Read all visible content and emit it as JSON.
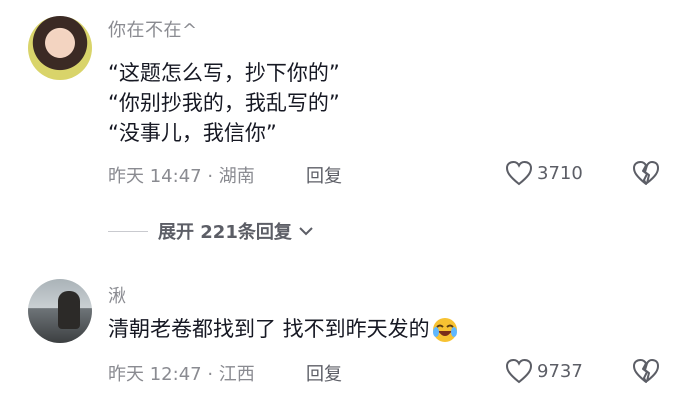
{
  "comments": [
    {
      "username": "你在不在^",
      "lines": [
        "“这题怎么写，抄下你的”",
        "“你别抄我的，我乱写的”",
        "“没事儿，我信你”"
      ],
      "time_location": "昨天 14:47 · 湖南",
      "reply_label": "回复",
      "likes": "3710"
    },
    {
      "username": "湫",
      "text": "清朝老卷都找到了 找不到昨天发的",
      "emoji": "laughing-crying-emoji",
      "time_location": "昨天 12:47 · 江西",
      "reply_label": "回复",
      "likes": "9737"
    }
  ],
  "expand_replies": "展开 221条回复"
}
